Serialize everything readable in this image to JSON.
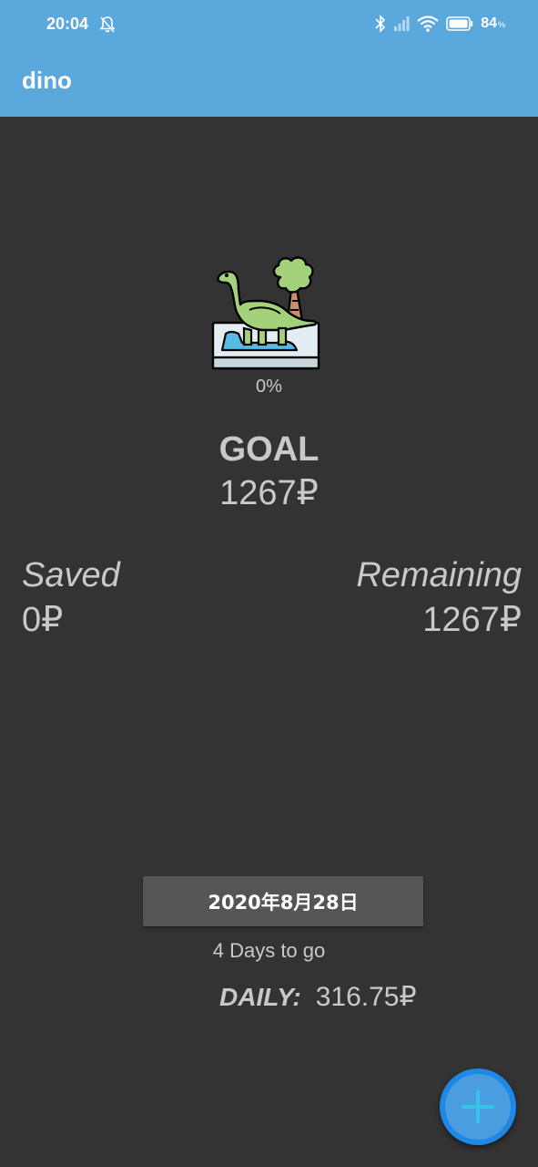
{
  "status_bar": {
    "time": "20:04",
    "battery_percent": "84",
    "battery_unit": "%",
    "icons": [
      "bell-off-icon",
      "bluetooth-icon",
      "signal-icon",
      "wifi-icon",
      "battery-icon"
    ]
  },
  "app_bar": {
    "title": "dino"
  },
  "progress": {
    "percent_text": "0%",
    "image_icon": "dinosaur-icon"
  },
  "goal": {
    "label": "GOAL",
    "value": "1267₽"
  },
  "saved": {
    "label": "Saved",
    "value": "0₽"
  },
  "remaining": {
    "label": "Remaining",
    "value": "1267₽"
  },
  "date_button": {
    "label": "2020年8月28日"
  },
  "days_to_go": "4 Days to go",
  "daily": {
    "label": "DAILY:",
    "value": "316.75₽"
  },
  "fab": {
    "icon": "plus-icon"
  },
  "colors": {
    "app_bar": "#5BA8DD",
    "background": "#333333",
    "text": "#C9C9C9",
    "date_button": "#555555",
    "fab": "#4A9EDF",
    "fab_ring": "#1E88E5",
    "fab_plus": "#36C5E8"
  }
}
